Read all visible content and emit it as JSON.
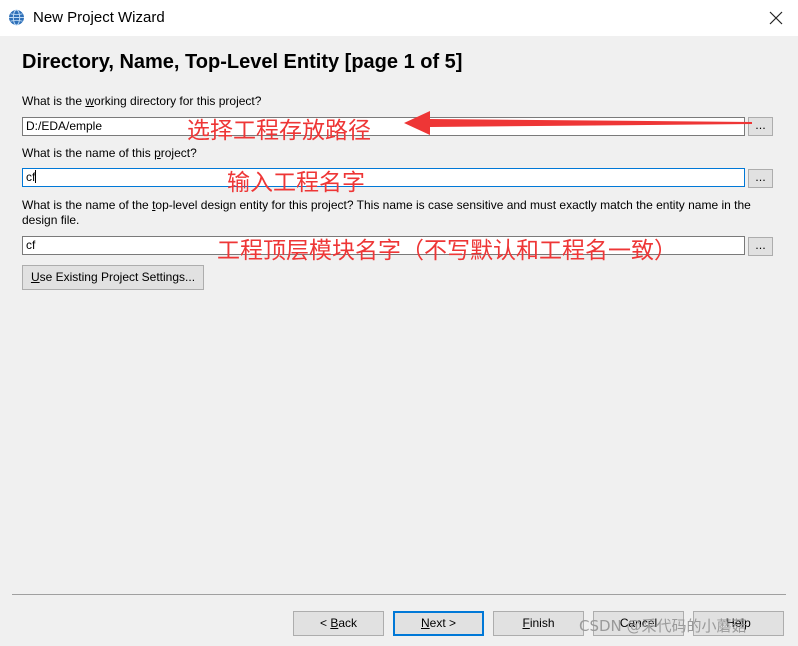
{
  "window": {
    "title": "New Project Wizard"
  },
  "page": {
    "heading": "Directory, Name, Top-Level Entity [page 1 of 5]"
  },
  "q1": {
    "pre": "What is the ",
    "mn": "w",
    "post": "orking directory for this project?",
    "value": "D:/EDA/emple"
  },
  "q2": {
    "pre": "What is the name of this ",
    "mn": "p",
    "post": "roject?",
    "value": "cf"
  },
  "q3": {
    "pre": "What is the name of the ",
    "mn": "t",
    "post": "op-level design entity for this project? This name is case sensitive and must exactly match the entity name in the design file.",
    "value": "cf"
  },
  "browse_label": "...",
  "existing_btn": {
    "mn": "U",
    "rest": "se Existing Project Settings..."
  },
  "footer": {
    "back_pre": "< ",
    "back_mn": "B",
    "back_rest": "ack",
    "next_mn": "N",
    "next_rest": "ext >",
    "finish_mn": "F",
    "finish_rest": "inish",
    "cancel": "Cancel",
    "help": "Help"
  },
  "annotations": {
    "a1": "选择工程存放路径",
    "a2": "输入工程名字",
    "a3": "工程顶层模块名字（不写默认和工程名一致）",
    "color": "#ee3636"
  },
  "watermark": "CSDN @采代码的小蘑菇"
}
